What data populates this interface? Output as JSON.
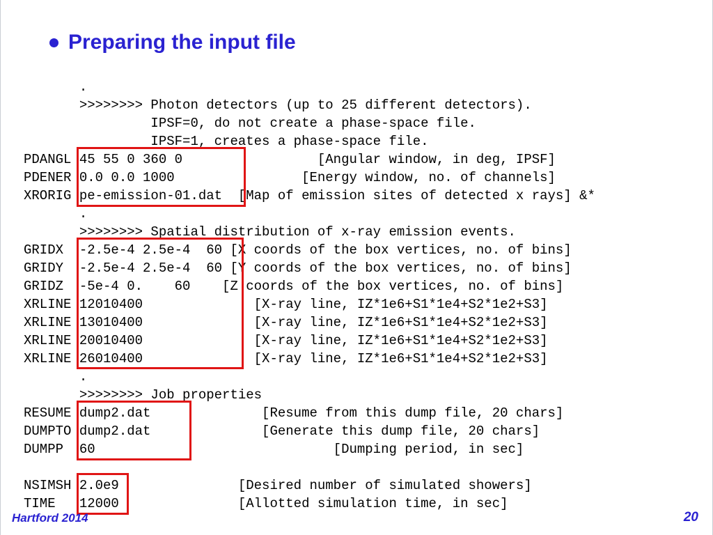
{
  "title": "Preparing the input file",
  "footer_left": "Hartford 2014",
  "footer_right": "20",
  "lines": {
    "l00": "       .",
    "l01": "       >>>>>>>> Photon detectors (up to 25 different detectors).",
    "l02": "                IPSF=0, do not create a phase-space file.",
    "l03": "                IPSF=1, creates a phase-space file.",
    "l04": "PDANGL 45 55 0 360 0                 [Angular window, in deg, IPSF]",
    "l05": "PDENER 0.0 0.0 1000                [Energy window, no. of channels]",
    "l06": "XRORIG pe-emission-01.dat  [Map of emission sites of detected x rays] &*",
    "l07": "       .",
    "l08": "       >>>>>>>> Spatial distribution of x-ray emission events.",
    "l09": "GRIDX  -2.5e-4 2.5e-4  60 [X coords of the box vertices, no. of bins]",
    "l10": "GRIDY  -2.5e-4 2.5e-4  60 [Y coords of the box vertices, no. of bins]",
    "l11": "GRIDZ  -5e-4 0.    60    [Z coords of the box vertices, no. of bins]",
    "l12": "XRLINE 12010400              [X-ray line, IZ*1e6+S1*1e4+S2*1e2+S3]",
    "l13": "XRLINE 13010400              [X-ray line, IZ*1e6+S1*1e4+S2*1e2+S3]",
    "l14": "XRLINE 20010400              [X-ray line, IZ*1e6+S1*1e4+S2*1e2+S3]",
    "l15": "XRLINE 26010400              [X-ray line, IZ*1e6+S1*1e4+S2*1e2+S3]",
    "l16": "       .",
    "l17": "       >>>>>>>> Job properties",
    "l18": "RESUME dump2.dat              [Resume from this dump file, 20 chars]",
    "l19": "DUMPTO dump2.dat              [Generate this dump file, 20 chars]",
    "l20": "DUMPP  60                              [Dumping period, in sec]",
    "l21": "",
    "l22": "NSIMSH 2.0e9               [Desired number of simulated showers]",
    "l23": "TIME   12000               [Allotted simulation time, in sec]"
  }
}
